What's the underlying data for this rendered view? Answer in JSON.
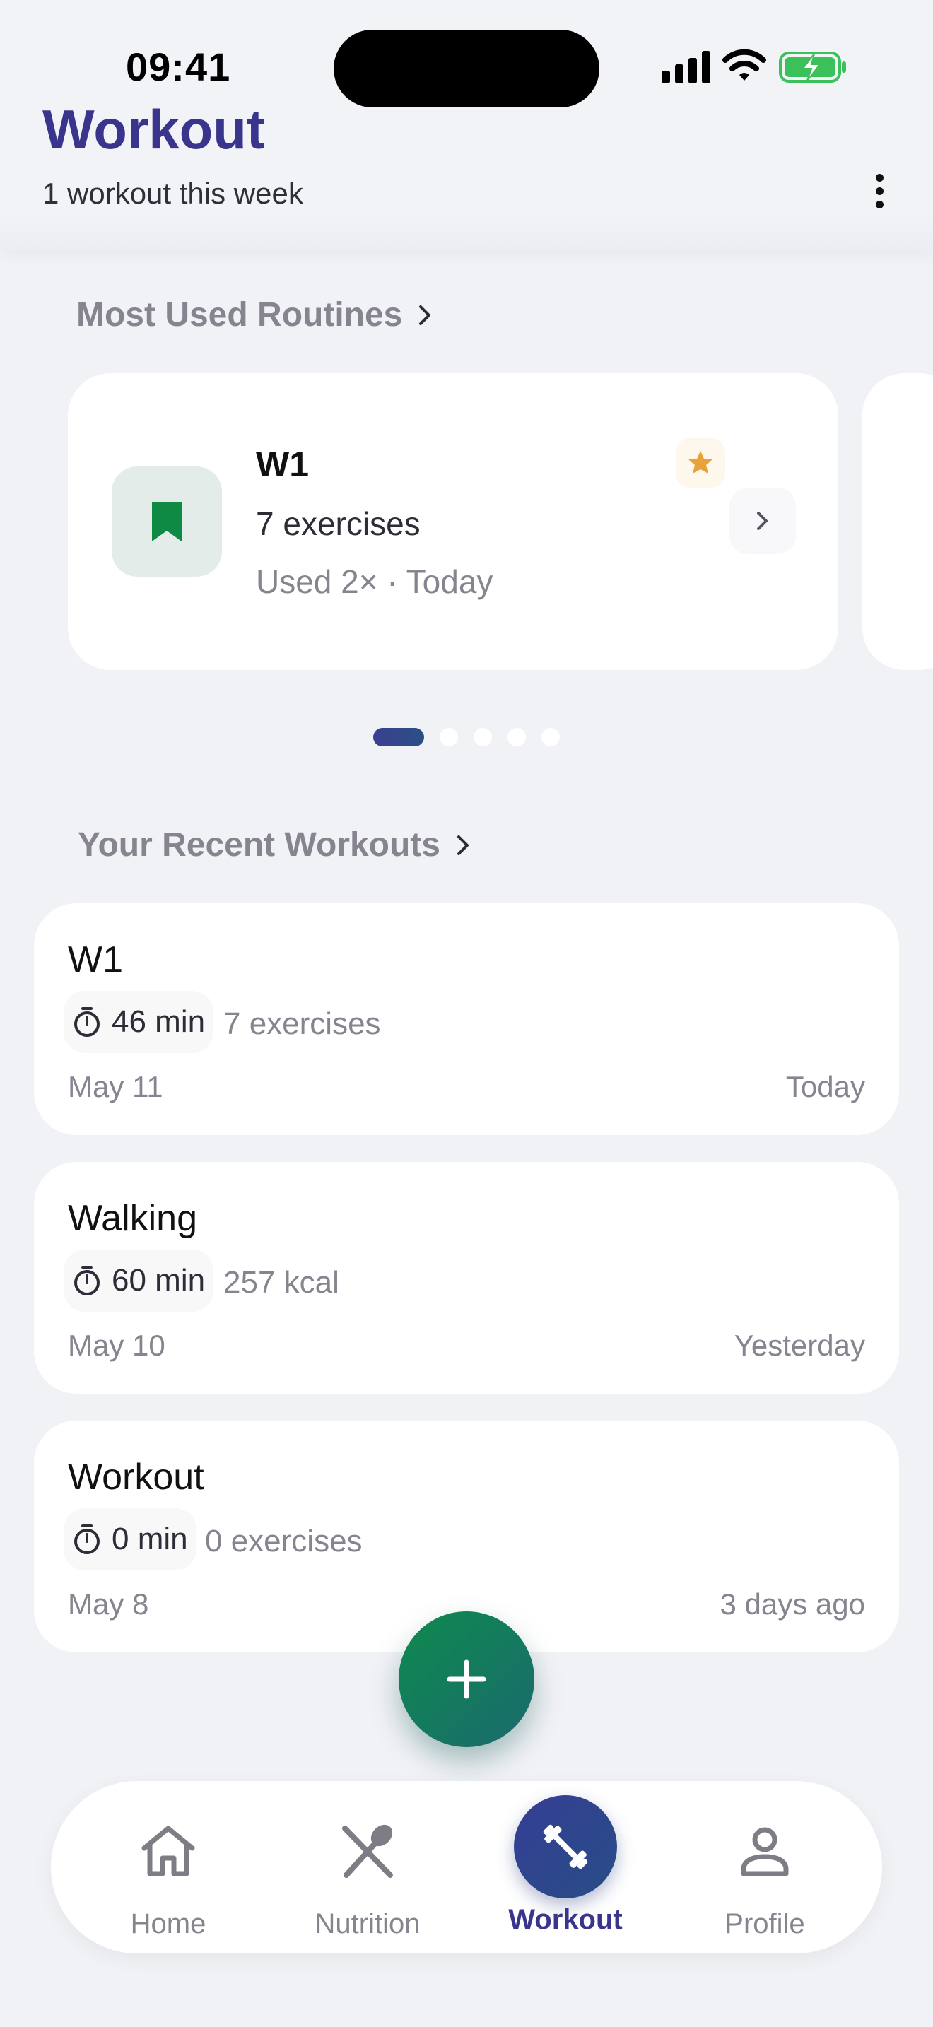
{
  "status_bar": {
    "time": "09:41"
  },
  "header": {
    "title": "Workout",
    "subtitle": "1 workout this week"
  },
  "routines": {
    "section_title": "Most Used Routines",
    "card": {
      "name": "W1",
      "exercises": "7 exercises",
      "used": "Used 2× · Today",
      "starred": true
    },
    "carousel": {
      "total_pages": 5,
      "active_page": 1
    }
  },
  "recent": {
    "section_title": "Your Recent Workouts",
    "items": [
      {
        "title": "W1",
        "duration": "46 min",
        "meta": "7 exercises",
        "date": "May 11",
        "relative": "Today"
      },
      {
        "title": "Walking",
        "duration": "60 min",
        "meta": "257 kcal",
        "date": "May 10",
        "relative": "Yesterday"
      },
      {
        "title": "Workout",
        "duration": "0 min",
        "meta": "0 exercises",
        "date": "May 8",
        "relative": "3 days ago"
      }
    ]
  },
  "fab": {
    "icon": "plus-icon"
  },
  "nav": {
    "home": "Home",
    "nutrition": "Nutrition",
    "workout": "Workout",
    "profile": "Profile",
    "active": "workout"
  },
  "colors": {
    "title": "#3a358c",
    "routine_icon": "#0f8a45",
    "star": "#e9a23b",
    "fab": "#0e8a4d",
    "nav_active": "#2f4690"
  }
}
